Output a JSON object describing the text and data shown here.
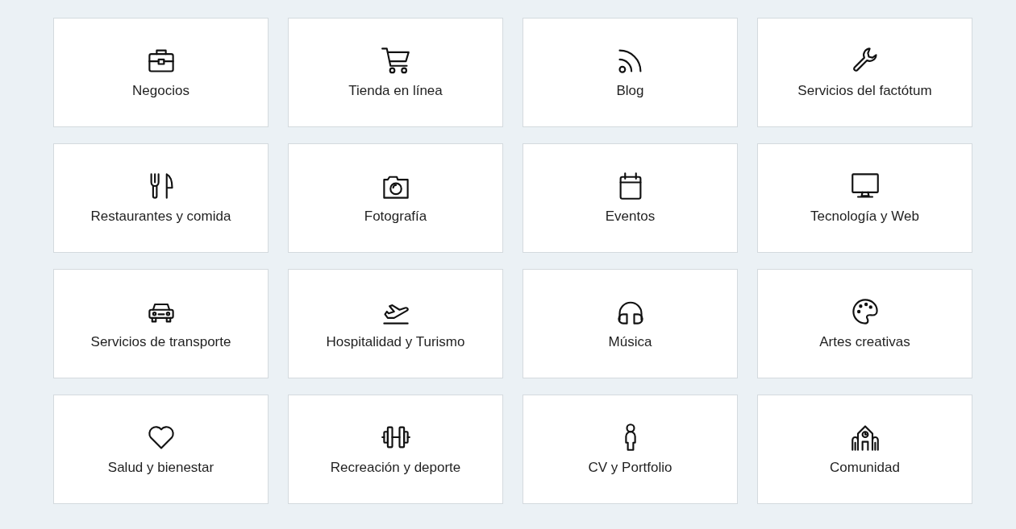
{
  "categories": [
    {
      "label": "Negocios"
    },
    {
      "label": "Tienda en línea"
    },
    {
      "label": "Blog"
    },
    {
      "label": "Servicios del factótum"
    },
    {
      "label": "Restaurantes y comida"
    },
    {
      "label": "Fotografía"
    },
    {
      "label": "Eventos"
    },
    {
      "label": "Tecnología y Web"
    },
    {
      "label": "Servicios de transporte"
    },
    {
      "label": "Hospitalidad y Turismo"
    },
    {
      "label": "Música"
    },
    {
      "label": "Artes creativas"
    },
    {
      "label": "Salud y bienestar"
    },
    {
      "label": "Recreación y deporte"
    },
    {
      "label": "CV y Portfolio"
    },
    {
      "label": "Comunidad"
    }
  ]
}
